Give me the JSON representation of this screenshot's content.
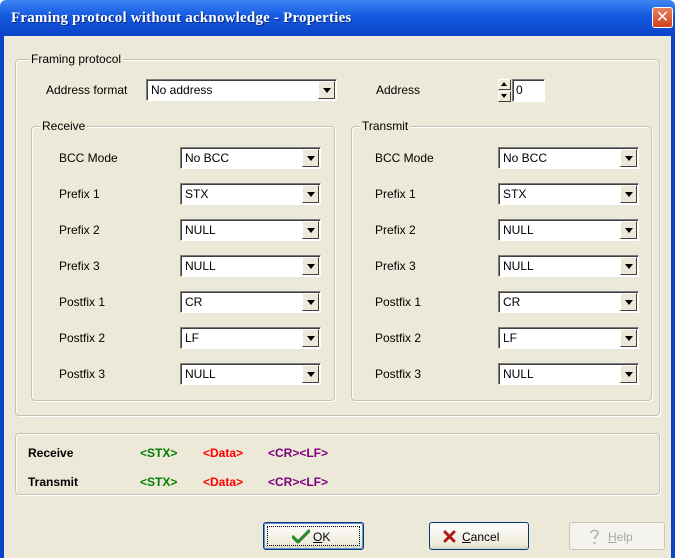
{
  "window": {
    "title": "Framing protocol without acknowledge - Properties",
    "close_glyph": "✕"
  },
  "framing": {
    "legend": "Framing protocol",
    "address_format_label": "Address format",
    "address_format_value": "No address",
    "address_label": "Address",
    "address_value": "0"
  },
  "receive": {
    "legend": "Receive",
    "rows": [
      {
        "label": "BCC Mode",
        "value": "No BCC"
      },
      {
        "label": "Prefix 1",
        "value": "STX"
      },
      {
        "label": "Prefix 2",
        "value": "NULL"
      },
      {
        "label": "Prefix 3",
        "value": "NULL"
      },
      {
        "label": "Postfix 1",
        "value": "CR"
      },
      {
        "label": "Postfix 2",
        "value": "LF"
      },
      {
        "label": "Postfix 3",
        "value": "NULL"
      }
    ]
  },
  "transmit": {
    "legend": "Transmit",
    "rows": [
      {
        "label": "BCC Mode",
        "value": "No BCC"
      },
      {
        "label": "Prefix 1",
        "value": "STX"
      },
      {
        "label": "Prefix 2",
        "value": "NULL"
      },
      {
        "label": "Prefix 3",
        "value": "NULL"
      },
      {
        "label": "Postfix 1",
        "value": "CR"
      },
      {
        "label": "Postfix 2",
        "value": "LF"
      },
      {
        "label": "Postfix 3",
        "value": "NULL"
      }
    ]
  },
  "summary": {
    "receive_label": "Receive",
    "transmit_label": "Transmit",
    "receive_prefix": "<STX>",
    "receive_data": "<Data>",
    "receive_postfix": "<CR><LF>",
    "transmit_prefix": "<STX>",
    "transmit_data": "<Data>",
    "transmit_postfix": "<CR><LF>"
  },
  "buttons": {
    "ok_label_underlined": "O",
    "ok_label_rest": "K",
    "cancel_label_underlined": "C",
    "cancel_label_rest": "ancel",
    "help_label_underlined": "H",
    "help_label_rest": "elp"
  },
  "colors": {
    "prefix": "#008000",
    "data": "#ff0000",
    "postfix": "#800080",
    "titlebar": "#0a44c8",
    "dialog_bg": "#ece9d8"
  },
  "icons": {
    "ok": "checkmark-icon",
    "cancel": "x-icon",
    "help": "question-icon"
  }
}
